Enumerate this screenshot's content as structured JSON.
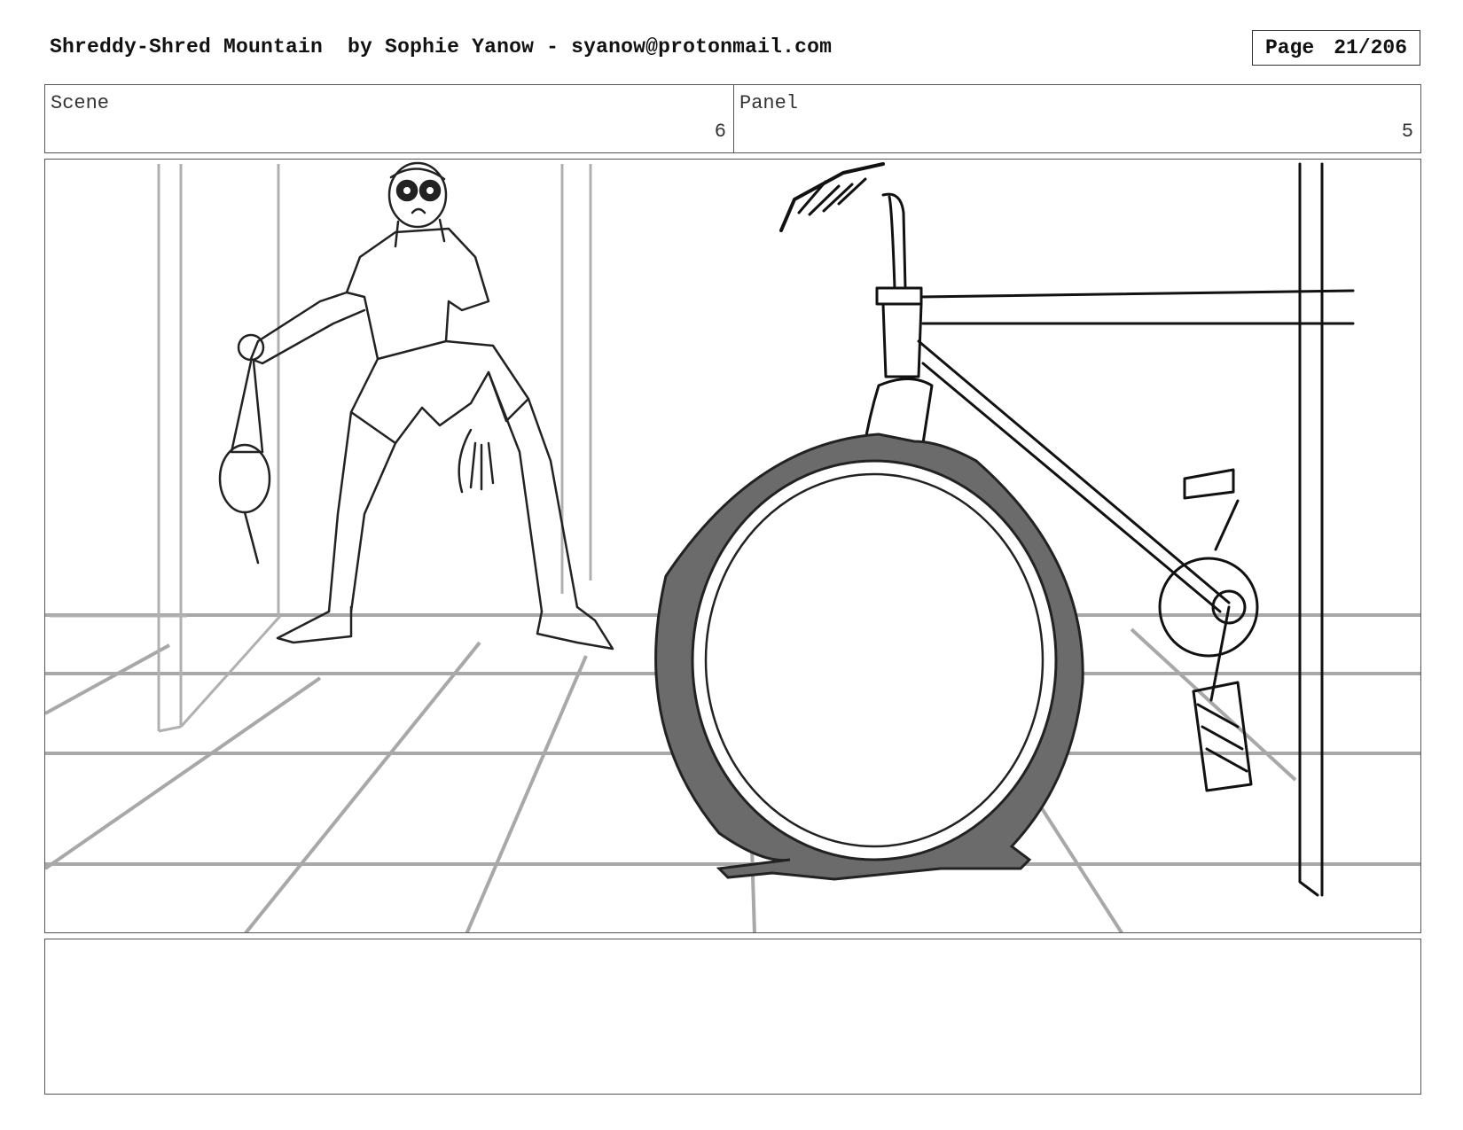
{
  "header": {
    "title": "Shreddy-Shred Mountain  by Sophie Yanow - syanow@protonmail.com",
    "page_label": "Page",
    "page_number": "21/206"
  },
  "info": {
    "scene_label": "Scene",
    "scene_value": "6",
    "panel_label": "Panel",
    "panel_value": "5"
  },
  "notes": {
    "text": ""
  }
}
